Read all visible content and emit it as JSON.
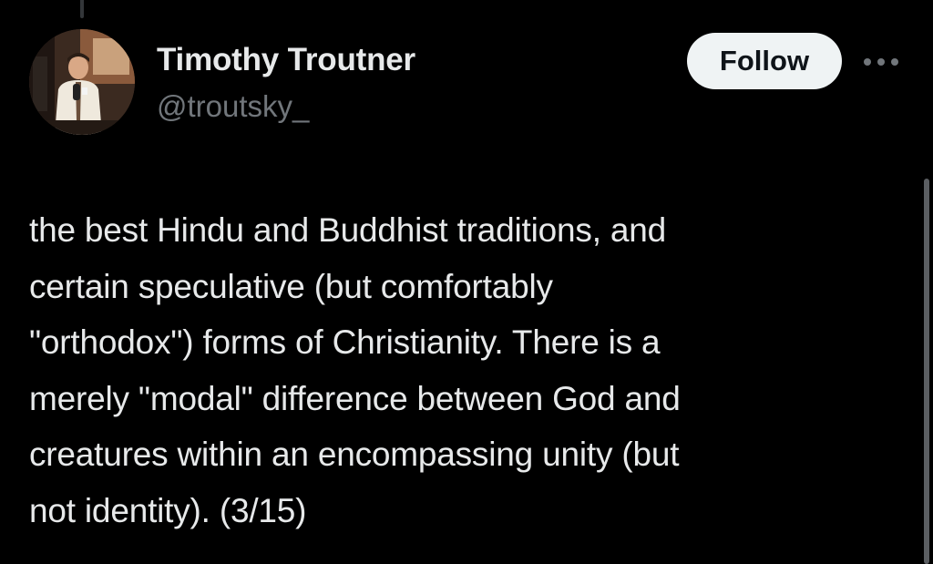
{
  "tweet": {
    "author_name": "Timothy Troutner",
    "author_handle": "@troutsky_",
    "follow_label": "Follow",
    "more_icon": "more-horizontal-icon",
    "text": "the best Hindu and Buddhist traditions, and\ncertain speculative (but comfortably\n\"orthodox\") forms of Christianity. There is a\nmerely \"modal\" difference between God and\ncreatures within an encompassing unity (but\nnot identity). (3/15)"
  },
  "colors": {
    "background": "#000000",
    "primary_text": "#e7e9ea",
    "secondary_text": "#71767b",
    "follow_button_bg": "#eff3f4",
    "follow_button_text": "#0f1419"
  }
}
